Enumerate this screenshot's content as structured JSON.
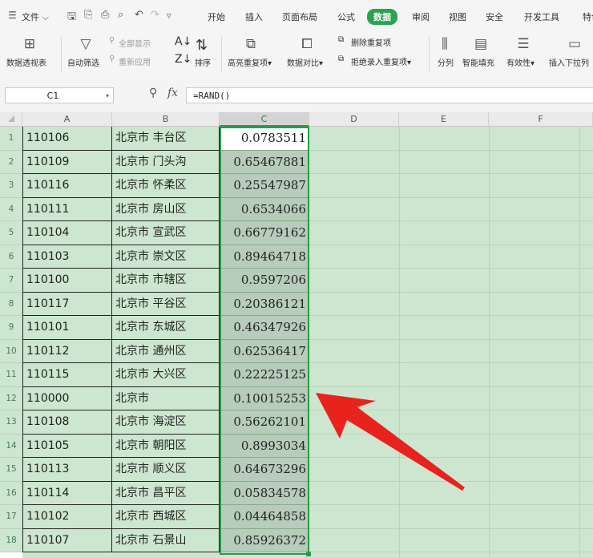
{
  "menu": {
    "file_label": "文件",
    "tabs": [
      "开始",
      "插入",
      "页面布局",
      "公式",
      "数据",
      "审阅",
      "视图",
      "安全",
      "开发工具",
      "特色"
    ],
    "active_tab": "数据"
  },
  "ribbon": {
    "pivot_table": "数据透视表",
    "auto_filter": "自动筛选",
    "show_all": "全部显示",
    "reapply": "重新应用",
    "sort": "排序",
    "highlight_dup": "高亮重复项",
    "compare": "数据对比",
    "remove_dup": "删除重复项",
    "reject_dup": "拒绝录入重复项",
    "split": "分列",
    "flash_fill": "智能填充",
    "validity": "有效性",
    "insert_dropdown": "插入下拉列"
  },
  "formula_bar": {
    "name_box": "C1",
    "fx": "fx",
    "formula": "=RAND()"
  },
  "columns": [
    "A",
    "B",
    "C",
    "D",
    "E",
    "F"
  ],
  "selected_column": "C",
  "rows": [
    {
      "n": "1",
      "a": "110106",
      "b": "北京市 丰台区",
      "c": "0.0783511"
    },
    {
      "n": "2",
      "a": "110109",
      "b": "北京市 门头沟",
      "c": "0.65467881"
    },
    {
      "n": "3",
      "a": "110116",
      "b": "北京市 怀柔区",
      "c": "0.25547987"
    },
    {
      "n": "4",
      "a": "110111",
      "b": "北京市 房山区",
      "c": "0.6534066"
    },
    {
      "n": "5",
      "a": "110104",
      "b": "北京市 宣武区",
      "c": "0.66779162"
    },
    {
      "n": "6",
      "a": "110103",
      "b": "北京市 崇文区",
      "c": "0.89464718"
    },
    {
      "n": "7",
      "a": "110100",
      "b": "北京市 市辖区",
      "c": "0.9597206"
    },
    {
      "n": "8",
      "a": "110117",
      "b": "北京市 平谷区",
      "c": "0.20386121"
    },
    {
      "n": "9",
      "a": "110101",
      "b": "北京市 东城区",
      "c": "0.46347926"
    },
    {
      "n": "10",
      "a": "110112",
      "b": "北京市 通州区",
      "c": "0.62536417"
    },
    {
      "n": "11",
      "a": "110115",
      "b": "北京市 大兴区",
      "c": "0.22225125"
    },
    {
      "n": "12",
      "a": "110000",
      "b": "北京市",
      "c": "0.10015253"
    },
    {
      "n": "13",
      "a": "110108",
      "b": "北京市 海淀区",
      "c": "0.56262101"
    },
    {
      "n": "14",
      "a": "110105",
      "b": "北京市 朝阳区",
      "c": "0.8993034"
    },
    {
      "n": "15",
      "a": "110113",
      "b": "北京市 顺义区",
      "c": "0.64673296"
    },
    {
      "n": "16",
      "a": "110114",
      "b": "北京市 昌平区",
      "c": "0.05834578"
    },
    {
      "n": "17",
      "a": "110102",
      "b": "北京市 西城区",
      "c": "0.04464858"
    },
    {
      "n": "18",
      "a": "110107",
      "b": "北京市 石景山",
      "c": "0.85926372"
    }
  ],
  "colors": {
    "accent_green": "#2aa44f",
    "grid_fill": "#cde6cf",
    "selection": "#2a9a4a",
    "annotation_arrow": "#e8231d"
  }
}
